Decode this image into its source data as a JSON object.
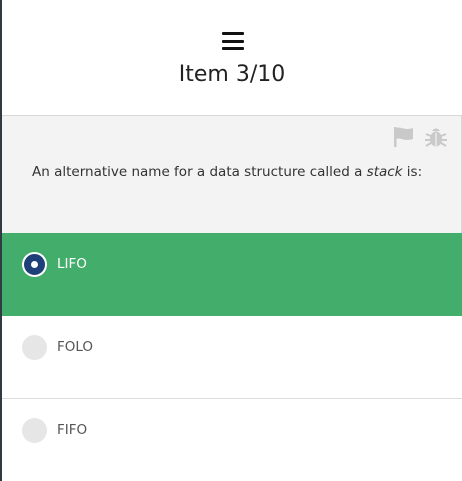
{
  "header": {
    "menu_icon": "hamburger-menu-icon",
    "item_counter": "Item 3/10"
  },
  "question": {
    "text_before": "An alternative name for a data structure called a ",
    "emphasis": "stack",
    "text_after": " is:",
    "icons": [
      "flag-icon",
      "bug-icon"
    ],
    "icon_color": "#c9c9c9"
  },
  "answers": [
    {
      "label": "LIFO",
      "selected": true
    },
    {
      "label": "FOLO",
      "selected": false
    },
    {
      "label": "FIFO",
      "selected": false
    }
  ],
  "colors": {
    "selected_background": "#43ad6b",
    "radio_checked": "#1e3f78",
    "question_background": "#f3f3f3"
  }
}
